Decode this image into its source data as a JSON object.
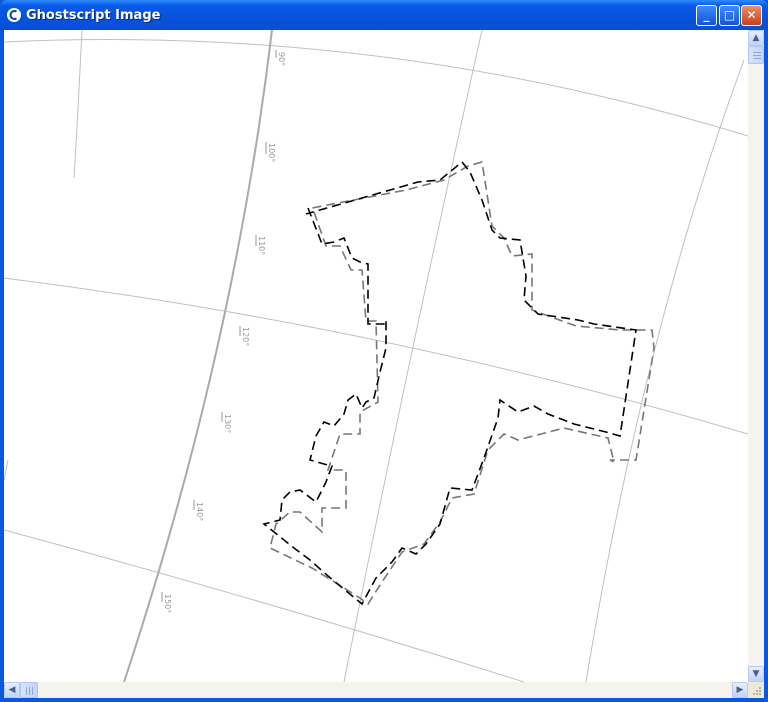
{
  "window": {
    "title": "Ghostscript Image",
    "minimize_glyph": "_",
    "maximize_glyph": "□",
    "close_glyph": "✕",
    "app_icon": "ghostscript-icon"
  },
  "map": {
    "longitude_labels": [
      "90°",
      "100°",
      "110°",
      "120°",
      "130°",
      "140°",
      "150°"
    ],
    "colors": {
      "graticule": "#c0c0c0",
      "meridian_main": "#aaaaaa",
      "outline_black": "#000000",
      "outline_gray": "#777777"
    }
  },
  "scrollbars": {
    "up_arrow": "▲",
    "down_arrow": "▼",
    "left_arrow": "◀",
    "right_arrow": "▶"
  }
}
